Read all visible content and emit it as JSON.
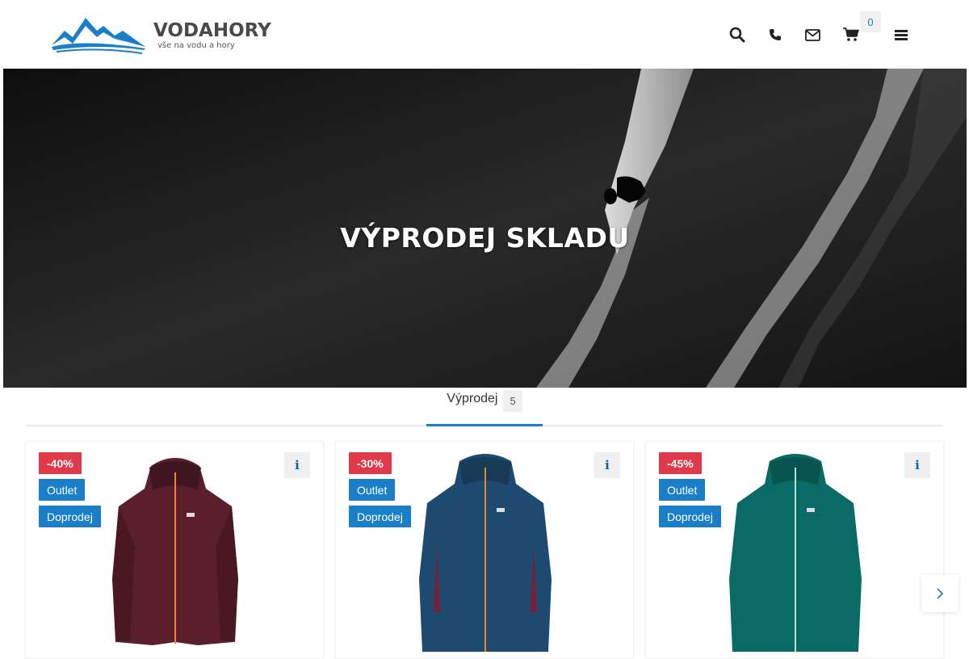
{
  "header": {
    "logo_name": "VODAHORY",
    "logo_tagline": "vše na vodu a hory",
    "icons": [
      "search-icon",
      "phone-icon",
      "envelope-icon",
      "cart-icon",
      "menu-icon"
    ],
    "cart_count": "0"
  },
  "hero": {
    "title": "VÝPRODEJ SKLADU"
  },
  "tabs": [
    {
      "label": "Výprodej",
      "count": "5"
    }
  ],
  "products": [
    {
      "discount": "-40%",
      "badge_outlet": "Outlet",
      "badge_doprodej": "Doprodej",
      "color": "#5b1f2b",
      "zip": "#e8872b"
    },
    {
      "discount": "-30%",
      "badge_outlet": "Outlet",
      "badge_doprodej": "Doprodej",
      "color": "#1d4a6e",
      "zip": "#e8872b"
    },
    {
      "discount": "-45%",
      "badge_outlet": "Outlet",
      "badge_doprodej": "Doprodej",
      "color": "#0a6b66",
      "zip": "#b5e0d8"
    }
  ],
  "colors": {
    "accent": "#1a7fc8",
    "sale": "#e03a4a",
    "text": "#333333"
  }
}
